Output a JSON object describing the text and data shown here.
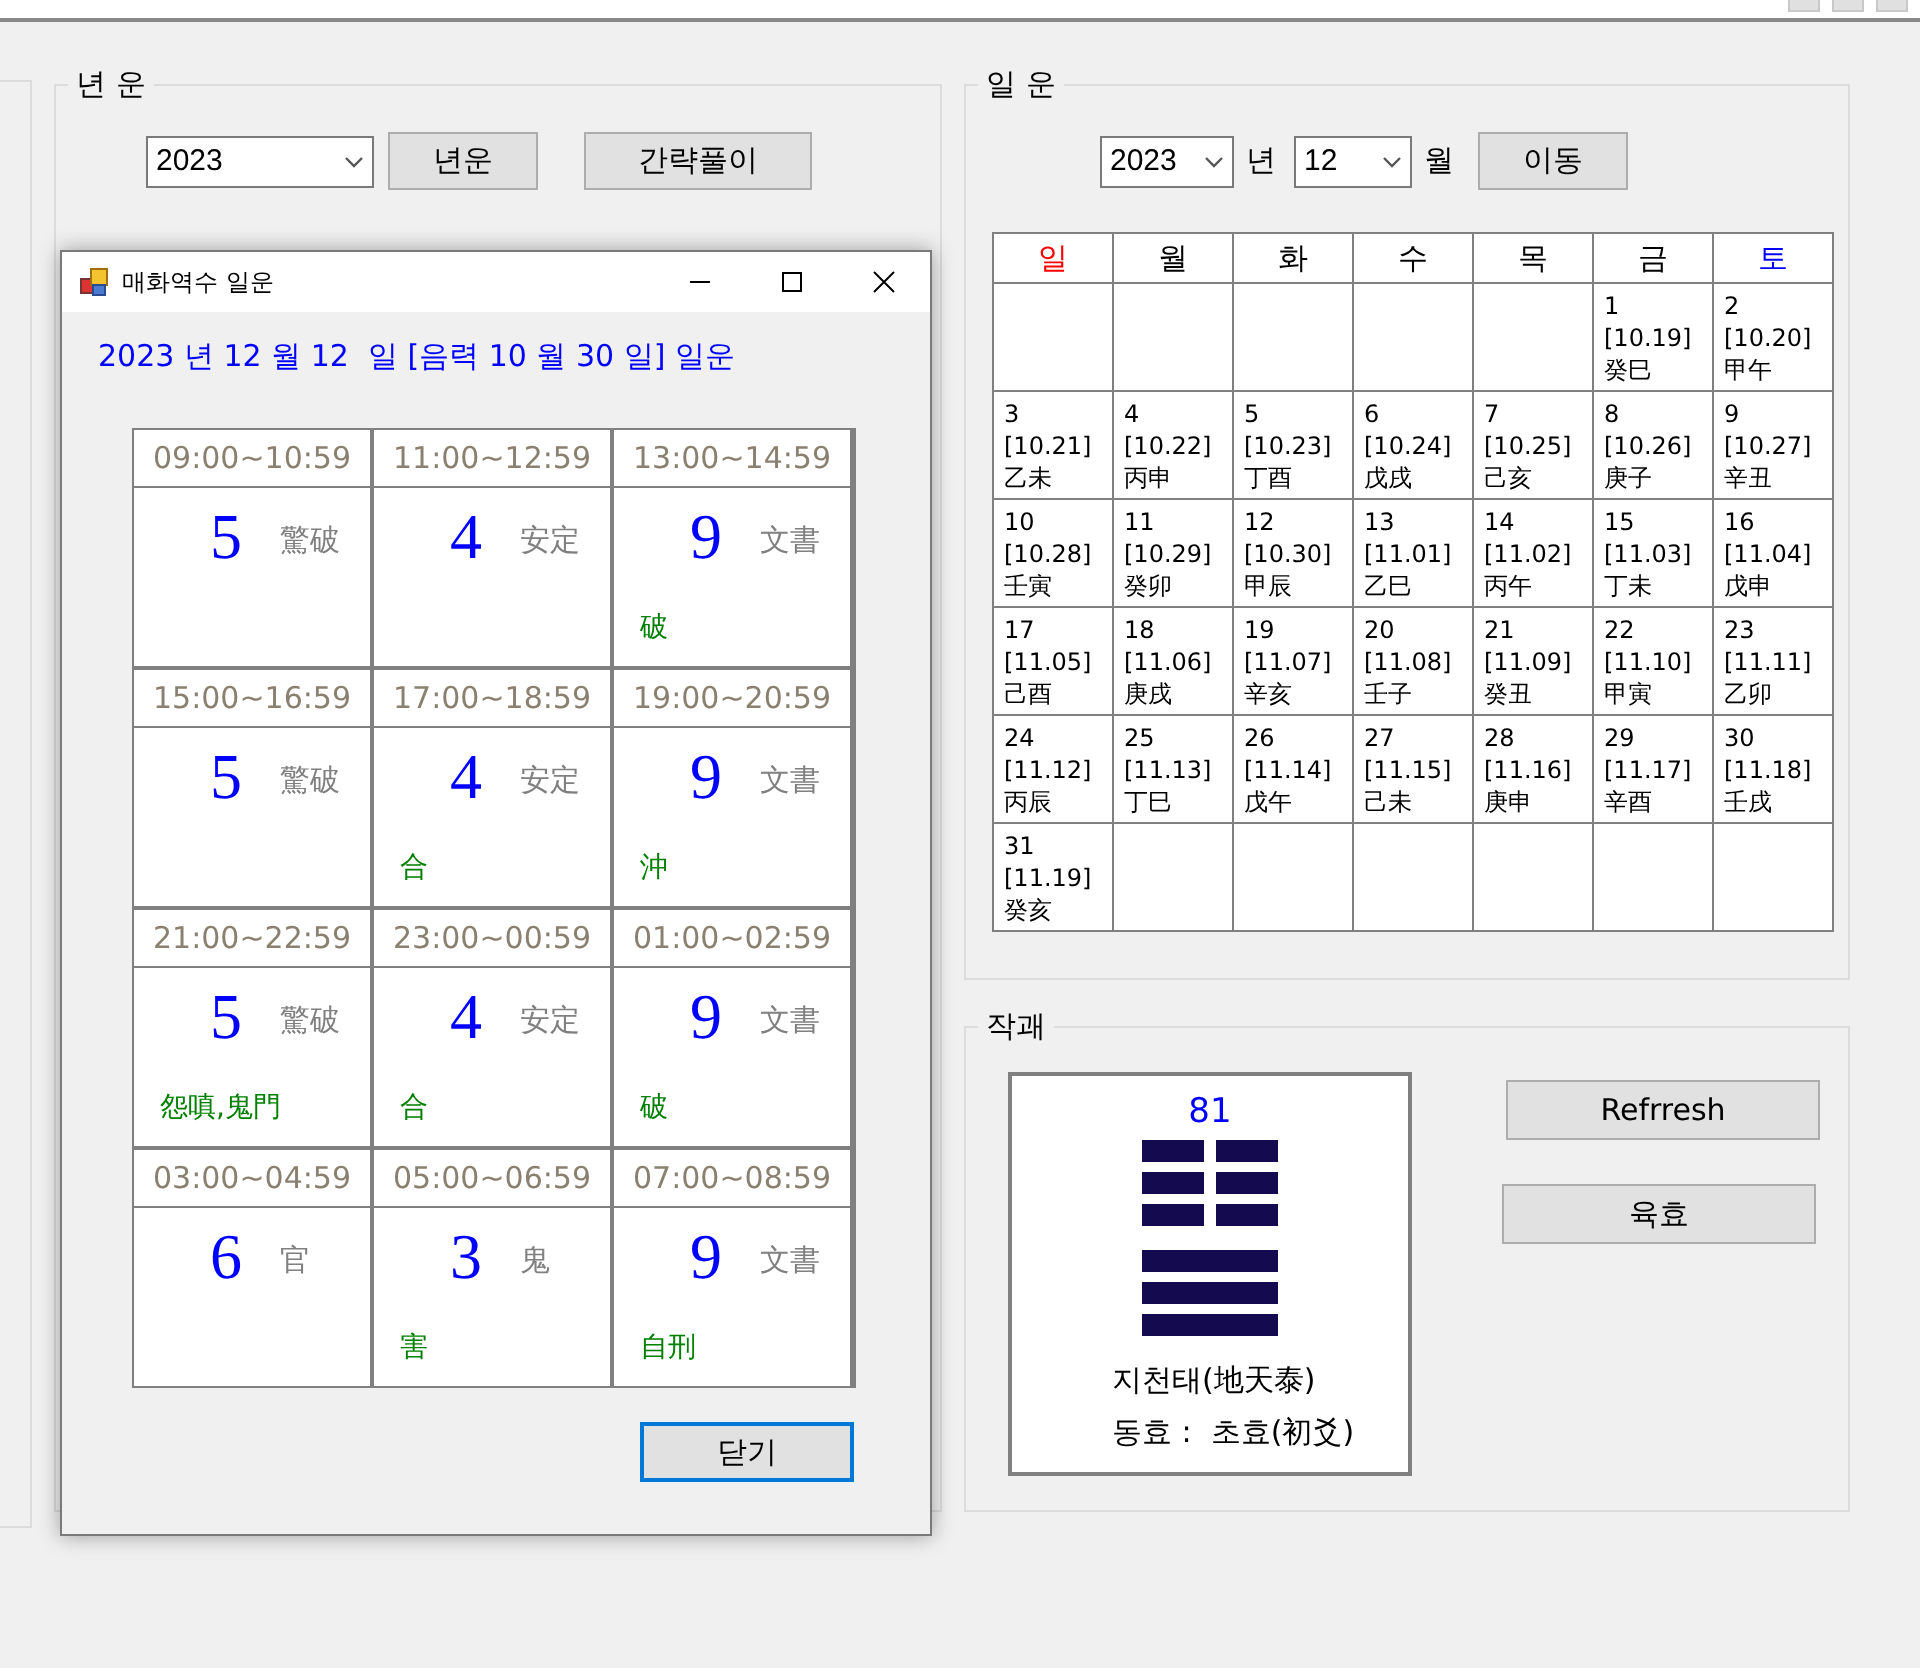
{
  "year_fortune": {
    "title": "년 운",
    "year_select": "2023",
    "buttons": [
      "년운",
      "간략풀이"
    ]
  },
  "daily_fortune": {
    "title": "일 운",
    "year_select": "2023",
    "year_unit": "년",
    "month_select": "12",
    "month_unit": "월",
    "go_button": "이동",
    "weekdays": [
      {
        "label": "일",
        "color": "#ff0000"
      },
      {
        "label": "월",
        "color": "#000000"
      },
      {
        "label": "화",
        "color": "#000000"
      },
      {
        "label": "수",
        "color": "#000000"
      },
      {
        "label": "목",
        "color": "#000000"
      },
      {
        "label": "금",
        "color": "#000000"
      },
      {
        "label": "토",
        "color": "#0000ff"
      }
    ],
    "weeks": [
      [
        {
          "kind": "blank"
        },
        {
          "kind": "blank"
        },
        {
          "kind": "blank"
        },
        {
          "kind": "blank"
        },
        {
          "kind": "blank"
        },
        {
          "kind": "day",
          "day": "1",
          "lunar": "[10.19]",
          "ganji": "癸巳"
        },
        {
          "kind": "day",
          "day": "2",
          "lunar": "[10.20]",
          "ganji": "甲午"
        }
      ],
      [
        {
          "kind": "day",
          "day": "3",
          "lunar": "[10.21]",
          "ganji": "乙未"
        },
        {
          "kind": "day",
          "day": "4",
          "lunar": "[10.22]",
          "ganji": "丙申"
        },
        {
          "kind": "day",
          "day": "5",
          "lunar": "[10.23]",
          "ganji": "丁酉"
        },
        {
          "kind": "day",
          "day": "6",
          "lunar": "[10.24]",
          "ganji": "戊戌"
        },
        {
          "kind": "day",
          "day": "7",
          "lunar": "[10.25]",
          "ganji": "己亥"
        },
        {
          "kind": "day",
          "day": "8",
          "lunar": "[10.26]",
          "ganji": "庚子"
        },
        {
          "kind": "day",
          "day": "9",
          "lunar": "[10.27]",
          "ganji": "辛丑"
        }
      ],
      [
        {
          "kind": "day",
          "day": "10",
          "lunar": "[10.28]",
          "ganji": "壬寅"
        },
        {
          "kind": "day",
          "day": "11",
          "lunar": "[10.29]",
          "ganji": "癸卯"
        },
        {
          "kind": "day",
          "day": "12",
          "lunar": "[10.30]",
          "ganji": "甲辰"
        },
        {
          "kind": "day",
          "day": "13",
          "lunar": "[11.01]",
          "ganji": "乙巳"
        },
        {
          "kind": "day",
          "day": "14",
          "lunar": "[11.02]",
          "ganji": "丙午"
        },
        {
          "kind": "day",
          "day": "15",
          "lunar": "[11.03]",
          "ganji": "丁未"
        },
        {
          "kind": "day",
          "day": "16",
          "lunar": "[11.04]",
          "ganji": "戊申"
        }
      ],
      [
        {
          "kind": "day",
          "day": "17",
          "lunar": "[11.05]",
          "ganji": "己酉"
        },
        {
          "kind": "day",
          "day": "18",
          "lunar": "[11.06]",
          "ganji": "庚戌"
        },
        {
          "kind": "day",
          "day": "19",
          "lunar": "[11.07]",
          "ganji": "辛亥"
        },
        {
          "kind": "day",
          "day": "20",
          "lunar": "[11.08]",
          "ganji": "壬子"
        },
        {
          "kind": "day",
          "day": "21",
          "lunar": "[11.09]",
          "ganji": "癸丑"
        },
        {
          "kind": "day",
          "day": "22",
          "lunar": "[11.10]",
          "ganji": "甲寅"
        },
        {
          "kind": "day",
          "day": "23",
          "lunar": "[11.11]",
          "ganji": "乙卯"
        }
      ],
      [
        {
          "kind": "day",
          "day": "24",
          "lunar": "[11.12]",
          "ganji": "丙辰"
        },
        {
          "kind": "day",
          "day": "25",
          "lunar": "[11.13]",
          "ganji": "丁巳"
        },
        {
          "kind": "day",
          "day": "26",
          "lunar": "[11.14]",
          "ganji": "戊午"
        },
        {
          "kind": "day",
          "day": "27",
          "lunar": "[11.15]",
          "ganji": "己未"
        },
        {
          "kind": "day",
          "day": "28",
          "lunar": "[11.16]",
          "ganji": "庚申"
        },
        {
          "kind": "day",
          "day": "29",
          "lunar": "[11.17]",
          "ganji": "辛酉"
        },
        {
          "kind": "day",
          "day": "30",
          "lunar": "[11.18]",
          "ganji": "壬戌"
        }
      ],
      [
        {
          "kind": "day",
          "day": "31",
          "lunar": "[11.19]",
          "ganji": "癸亥"
        },
        {
          "kind": "blank"
        },
        {
          "kind": "blank"
        },
        {
          "kind": "blank"
        },
        {
          "kind": "blank"
        },
        {
          "kind": "blank"
        },
        {
          "kind": "blank"
        }
      ]
    ]
  },
  "divination": {
    "title": "작괘",
    "number": "81",
    "lines": [
      {
        "kind": "yin"
      },
      {
        "kind": "yin"
      },
      {
        "kind": "yin"
      },
      {
        "kind": "yang"
      },
      {
        "kind": "yang"
      },
      {
        "kind": "yang"
      }
    ],
    "name": "지천태(地天泰)",
    "moving_line": "동효 :  초효(初爻)",
    "buttons": [
      "Refrresh",
      "육효"
    ]
  },
  "popup": {
    "title": "매화역수 일운",
    "heading": "2023 년 12 월 12  일 [음력 10 월 30 일] 일운",
    "close_button": "닫기",
    "cells": [
      {
        "time": "09:00~10:59",
        "number": "5",
        "label": "驚破"
      },
      {
        "time": "11:00~12:59",
        "number": "4",
        "label": "安定"
      },
      {
        "time": "13:00~14:59",
        "number": "9",
        "label": "文書",
        "note": "破"
      },
      {
        "time": "15:00~16:59",
        "number": "5",
        "label": "驚破"
      },
      {
        "time": "17:00~18:59",
        "number": "4",
        "label": "安定",
        "note": "合"
      },
      {
        "time": "19:00~20:59",
        "number": "9",
        "label": "文書",
        "note": "沖"
      },
      {
        "time": "21:00~22:59",
        "number": "5",
        "label": "驚破",
        "note": "怨嗔,鬼門"
      },
      {
        "time": "23:00~00:59",
        "number": "4",
        "label": "安定",
        "note": "合"
      },
      {
        "time": "01:00~02:59",
        "number": "9",
        "label": "文書",
        "note": "破"
      },
      {
        "time": "03:00~04:59",
        "number": "6",
        "label": "官"
      },
      {
        "time": "05:00~06:59",
        "number": "3",
        "label": "鬼",
        "note": "害"
      },
      {
        "time": "07:00~08:59",
        "number": "9",
        "label": "文書",
        "note": "自刑"
      }
    ]
  }
}
